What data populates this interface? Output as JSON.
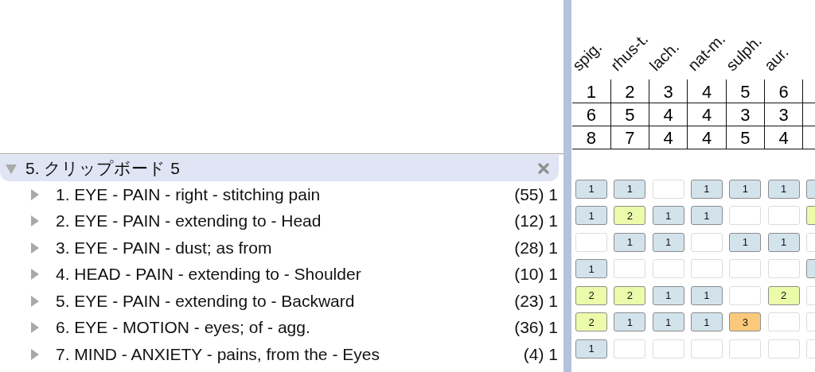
{
  "clipboard": {
    "title": "5. クリップボード 5",
    "expanded": true,
    "rubrics": [
      {
        "label": "1. EYE - PAIN - right - stitching pain",
        "count": "(55) 1"
      },
      {
        "label": "2. EYE - PAIN - extending to - Head",
        "count": "(12) 1"
      },
      {
        "label": "3. EYE - PAIN - dust; as from",
        "count": "(28) 1"
      },
      {
        "label": "4. HEAD - PAIN - extending to - Shoulder",
        "count": "(10) 1"
      },
      {
        "label": "5. EYE - PAIN - extending to - Backward",
        "count": "(23) 1"
      },
      {
        "label": "6. EYE - MOTION - eyes; of - agg.",
        "count": "(36) 1"
      },
      {
        "label": "7. MIND - ANXIETY - pains, from the - Eyes",
        "count": "(4) 1"
      }
    ]
  },
  "remedies": [
    {
      "name": "spig.",
      "rank": "1",
      "hits": "6",
      "score": "8"
    },
    {
      "name": "rhus-t.",
      "rank": "2",
      "hits": "5",
      "score": "7"
    },
    {
      "name": "lach.",
      "rank": "3",
      "hits": "4",
      "score": "4"
    },
    {
      "name": "nat-m.",
      "rank": "4",
      "hits": "4",
      "score": "4"
    },
    {
      "name": "sulph.",
      "rank": "5",
      "hits": "3",
      "score": "5"
    },
    {
      "name": "aur.",
      "rank": "6",
      "hits": "3",
      "score": "4"
    }
  ],
  "grid": [
    [
      {
        "kind": "hit",
        "color": "#d3e3ec",
        "grade": "1"
      },
      {
        "kind": "hit",
        "color": "#d3e3ec",
        "grade": "1"
      },
      {
        "kind": "empty"
      },
      {
        "kind": "hit",
        "color": "#d3e3ec",
        "grade": "1"
      },
      {
        "kind": "hit",
        "color": "#d3e3ec",
        "grade": "1"
      },
      {
        "kind": "hit",
        "color": "#d3e3ec",
        "grade": "1"
      },
      {
        "kind": "hit",
        "color": "#d3e3ec"
      }
    ],
    [
      {
        "kind": "hit",
        "color": "#d3e3ec",
        "grade": "1"
      },
      {
        "kind": "hit",
        "color": "#ecfbaa",
        "grade": "2"
      },
      {
        "kind": "hit",
        "color": "#d3e3ec",
        "grade": "1"
      },
      {
        "kind": "hit",
        "color": "#d3e3ec",
        "grade": "1"
      },
      {
        "kind": "empty"
      },
      {
        "kind": "empty"
      },
      {
        "kind": "hit",
        "color": "#ecfbaa"
      }
    ],
    [
      {
        "kind": "empty"
      },
      {
        "kind": "hit",
        "color": "#d3e3ec",
        "grade": "1"
      },
      {
        "kind": "hit",
        "color": "#d3e3ec",
        "grade": "1"
      },
      {
        "kind": "empty"
      },
      {
        "kind": "hit",
        "color": "#d3e3ec",
        "grade": "1"
      },
      {
        "kind": "hit",
        "color": "#d3e3ec",
        "grade": "1"
      },
      {
        "kind": "empty"
      }
    ],
    [
      {
        "kind": "hit",
        "color": "#d3e3ec",
        "grade": "1"
      },
      {
        "kind": "empty"
      },
      {
        "kind": "empty"
      },
      {
        "kind": "empty"
      },
      {
        "kind": "empty"
      },
      {
        "kind": "empty"
      },
      {
        "kind": "hit",
        "color": "#d3e3ec"
      }
    ],
    [
      {
        "kind": "hit",
        "color": "#ecfbaa",
        "grade": "2"
      },
      {
        "kind": "hit",
        "color": "#ecfbaa",
        "grade": "2"
      },
      {
        "kind": "hit",
        "color": "#d3e3ec",
        "grade": "1"
      },
      {
        "kind": "hit",
        "color": "#d3e3ec",
        "grade": "1"
      },
      {
        "kind": "empty"
      },
      {
        "kind": "hit",
        "color": "#ecfbaa",
        "grade": "2"
      },
      {
        "kind": "empty"
      }
    ],
    [
      {
        "kind": "hit",
        "color": "#ecfbaa",
        "grade": "2"
      },
      {
        "kind": "hit",
        "color": "#d3e3ec",
        "grade": "1"
      },
      {
        "kind": "hit",
        "color": "#d3e3ec",
        "grade": "1"
      },
      {
        "kind": "hit",
        "color": "#d3e3ec",
        "grade": "1"
      },
      {
        "kind": "hit",
        "color": "#fbc97c",
        "grade": "3"
      },
      {
        "kind": "empty"
      },
      {
        "kind": "empty"
      }
    ],
    [
      {
        "kind": "hit",
        "color": "#d3e3ec",
        "grade": "1"
      },
      {
        "kind": "empty"
      },
      {
        "kind": "empty"
      },
      {
        "kind": "empty"
      },
      {
        "kind": "empty"
      },
      {
        "kind": "empty"
      },
      {
        "kind": "empty"
      }
    ]
  ]
}
